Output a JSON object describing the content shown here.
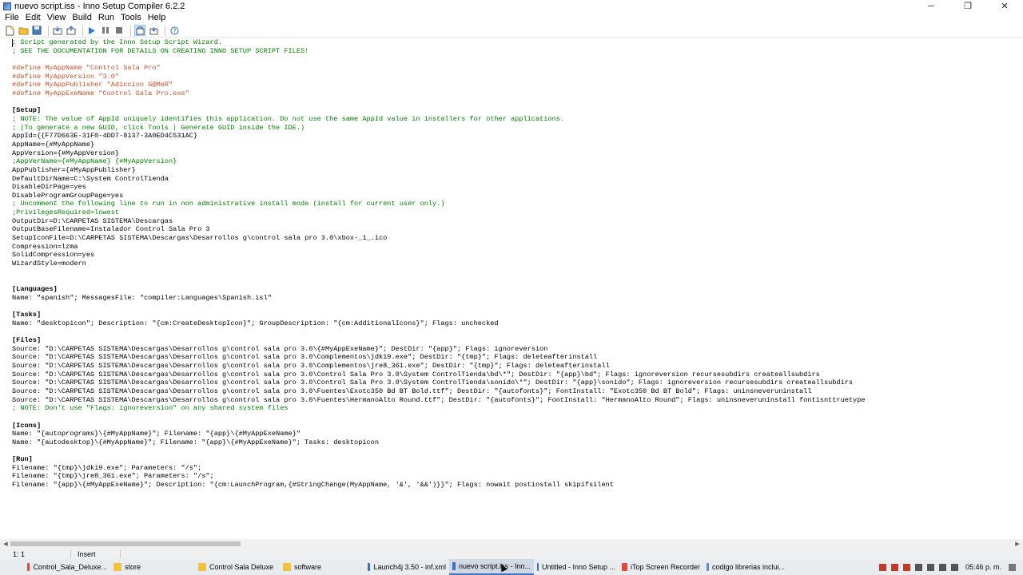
{
  "window": {
    "title": "nuevo script.iss - Inno Setup Compiler 6.2.2",
    "controls": {
      "minimize": "─",
      "maximize": "❐",
      "close": "✕"
    }
  },
  "menu": [
    "File",
    "Edit",
    "View",
    "Build",
    "Run",
    "Tools",
    "Help"
  ],
  "toolbar": [
    "new-file-icon",
    "open-folder-icon",
    "save-icon",
    "compile-icon",
    "compile-all-icon",
    "run-icon",
    "pause-icon",
    "stop-icon",
    "target-icon",
    "target-alt-icon",
    "help-icon"
  ],
  "editor": {
    "lines": [
      "; Script generated by the Inno Setup Script Wizard.",
      "; SEE THE DOCUMENTATION FOR DETAILS ON CREATING INNO SETUP SCRIPT FILES!",
      "",
      "#define MyAppName \"Control Sala Pro\"",
      "#define MyAppVersion \"3.0\"",
      "#define MyAppPublisher \"Adiccion G@MeR\"",
      "#define MyAppExeName \"Control Sala Pro.exe\"",
      "",
      "[Setup]",
      "; NOTE: The value of AppId uniquely identifies this application. Do not use the same AppId value in installers for other applications.",
      "; (To generate a new GUID, click Tools | Generate GUID inside the IDE.)",
      "AppId={{F77D663E-31F0-4DD7-8137-3A0ED4C531AC}",
      "AppName={#MyAppName}",
      "AppVersion={#MyAppVersion}",
      ";AppVerName={#MyAppName} {#MyAppVersion}",
      "AppPublisher={#MyAppPublisher}",
      "DefaultDirName=C:\\System ControlTienda",
      "DisableDirPage=yes",
      "DisableProgramGroupPage=yes",
      "; Uncomment the following line to run in non administrative install mode (install for current user only.)",
      ";PrivilegesRequired=lowest",
      "OutputDir=D:\\CARPETAS SISTEMA\\Descargas",
      "OutputBaseFilename=Instalador Control Sala Pro 3",
      "SetupIconFile=D:\\CARPETAS SISTEMA\\Descargas\\Desarrollos g\\control sala pro 3.0\\xbox-_1_.ico",
      "Compression=lzma",
      "SolidCompression=yes",
      "WizardStyle=modern",
      "",
      "",
      "[Languages]",
      "Name: \"spanish\"; MessagesFile: \"compiler:Languages\\Spanish.isl\"",
      "",
      "[Tasks]",
      "Name: \"desktopicon\"; Description: \"{cm:CreateDesktopIcon}\"; GroupDescription: \"{cm:AdditionalIcons}\"; Flags: unchecked",
      "",
      "[Files]",
      "Source: \"D:\\CARPETAS SISTEMA\\Descargas\\Desarrollos g\\control sala pro 3.0\\{#MyAppExeName}\"; DestDir: \"{app}\"; Flags: ignoreversion",
      "Source: \"D:\\CARPETAS SISTEMA\\Descargas\\Desarrollos g\\control sala pro 3.0\\Complementos\\jdk19.exe\"; DestDir: \"{tmp}\"; Flags: deleteafterinstall",
      "Source: \"D:\\CARPETAS SISTEMA\\Descargas\\Desarrollos g\\control sala pro 3.0\\Complementos\\jre8_361.exe\"; DestDir: \"{tmp}\"; Flags: deleteafterinstall",
      "Source: \"D:\\CARPETAS SISTEMA\\Descargas\\Desarrollos g\\control sala pro 3.0\\Control Sala Pro 3.0\\System ControlTienda\\bd\\*\"; DestDir: \"{app}\\bd\"; Flags: ignoreversion recursesubdirs createallsubdirs",
      "Source: \"D:\\CARPETAS SISTEMA\\Descargas\\Desarrollos g\\control sala pro 3.0\\Control Sala Pro 3.0\\System ControlTienda\\sonido\\*\"; DestDir: \"{app}\\sonido\"; Flags: ignoreversion recursesubdirs createallsubdirs",
      "Source: \"D:\\CARPETAS SISTEMA\\Descargas\\Desarrollos g\\control sala pro 3.0\\Fuentes\\Exotc350 Bd BT Bold.ttf\"; DestDir: \"{autofonts}\"; FontInstall: \"Exotc350 Bd BT Bold\"; Flags: uninsneveruninstall",
      "Source: \"D:\\CARPETAS SISTEMA\\Descargas\\Desarrollos g\\control sala pro 3.0\\Fuentes\\HermanoAlto Round.ttf\"; DestDir: \"{autofonts}\"; FontInstall: \"HermanoAlto Round\"; Flags: uninsneveruninstall fontisnttruetype",
      "; NOTE: Don't use \"Flags: ignoreversion\" on any shared system files",
      "",
      "[Icons]",
      "Name: \"{autoprograms}\\{#MyAppName}\"; Filename: \"{app}\\{#MyAppExeName}\"",
      "Name: \"{autodesktop}\\{#MyAppName}\"; Filename: \"{app}\\{#MyAppExeName}\"; Tasks: desktopicon",
      "",
      "[Run]",
      "Filename: \"{tmp}\\jdk19.exe\"; Parameters: \"/s\";",
      "Filename: \"{tmp}\\jre8_361.exe\"; Parameters: \"/s\";",
      "Filename: \"{app}\\{#MyAppExeName}\"; Description: \"{cm:LaunchProgram,{#StringChange(MyAppName, '&', '&&')}}\"; Flags: nowait postinstall skipifsilent"
    ]
  },
  "statusbar": {
    "position": "1:   1",
    "mode": "Insert"
  },
  "taskbar": {
    "items": [
      {
        "label": "Control_Sala_Deluxe...",
        "icon": "chrome-icon",
        "color": "#e8453c",
        "active": false
      },
      {
        "label": "store",
        "icon": "folder-icon",
        "color": "#f3c13a",
        "active": false
      },
      {
        "label": "Control Sala Deluxe",
        "icon": "folder-icon",
        "color": "#f3c13a",
        "active": false
      },
      {
        "label": "software",
        "icon": "folder-icon",
        "color": "#f3c13a",
        "active": false
      },
      {
        "label": "Launch4j 3.50 - inf.xml",
        "icon": "launch4j-icon",
        "color": "#3b6fb6",
        "active": false
      },
      {
        "label": "nuevo script.iss - Inn...",
        "icon": "inno-setup-icon",
        "color": "#3a6fc4",
        "active": true
      },
      {
        "label": "Untitled - Inno Setup ...",
        "icon": "inno-setup-icon",
        "color": "#3a6fc4",
        "active": false
      },
      {
        "label": "iTop Screen Recorder",
        "icon": "recorder-icon",
        "color": "#e8453c",
        "active": false
      },
      {
        "label": "codigo librerias inclui...",
        "icon": "notepad-icon",
        "color": "#5b8dd6",
        "active": false
      }
    ],
    "time": "05:46 p. m."
  }
}
